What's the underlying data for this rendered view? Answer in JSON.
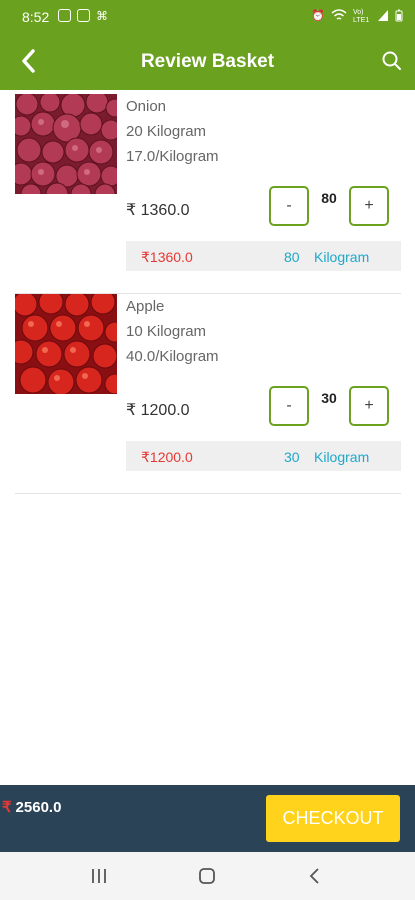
{
  "status_bar": {
    "time": "8:52",
    "left_icons": [
      "edit-icon",
      "image-icon",
      "usb-icon"
    ],
    "right_icons": [
      "alarm-icon",
      "wifi-icon",
      "volte-icon",
      "signal-icon",
      "battery-icon"
    ],
    "volte_label": "Vo) LTE1"
  },
  "app_bar": {
    "title": "Review Basket",
    "back_icon": "back-arrow-icon",
    "search_icon": "search-icon",
    "color": "#6aa11f"
  },
  "items": [
    {
      "name": "Onion",
      "quantity": "20 Kilogram",
      "rate": "17.0/Kilogram",
      "price": "₹ 1360.0",
      "minus_label": "-",
      "count": "80",
      "plus_label": "+",
      "summary_price": "₹1360.0",
      "summary_qty": "80",
      "summary_unit": "Kilogram",
      "image": "onion-image"
    },
    {
      "name": "Apple",
      "quantity": "10 Kilogram",
      "rate": "40.0/Kilogram",
      "price": "₹ 1200.0",
      "minus_label": "-",
      "count": "30",
      "plus_label": "+",
      "summary_price": "₹1200.0",
      "summary_qty": "30",
      "summary_unit": "Kilogram",
      "image": "apple-image"
    }
  ],
  "footer": {
    "currency": "₹",
    "total": "2560.0",
    "checkout_label": "CHECKOUT",
    "background": "#2b4356",
    "checkout_color": "#ffd21b"
  },
  "nav_bar": {
    "icons": [
      "recent-apps-icon",
      "home-icon",
      "back-icon"
    ]
  }
}
